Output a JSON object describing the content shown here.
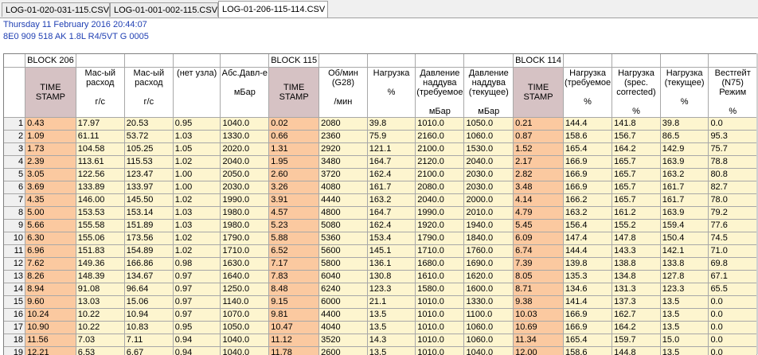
{
  "tabs": [
    "LOG-01-020-031-115.CSV",
    "LOG-01-001-002-115.CSV",
    "LOG-01-206-115-114.CSV"
  ],
  "active_tab": 2,
  "info": {
    "date": "Thursday 11 February 2016 20:44:07",
    "vehicle": "8E0 909 518 AK  1.8L R4/5VT     G    0005"
  },
  "blocks": {
    "b206": "BLOCK 206",
    "b115": "BLOCK 115",
    "b114": "BLOCK 114"
  },
  "headers": [
    {
      "top": "TIME STAMP",
      "unit": ""
    },
    {
      "top": "Мас-ый расход",
      "unit": "г/с"
    },
    {
      "top": "Мас-ый расход",
      "unit": "г/с"
    },
    {
      "top": "(нет узла)",
      "unit": ""
    },
    {
      "top": "Абс.Давл-е",
      "unit": "мБар"
    },
    {
      "top": "TIME STAMP",
      "unit": ""
    },
    {
      "top": "Об/мин (G28)",
      "unit": "/мин"
    },
    {
      "top": "Нагрузка",
      "unit": "%"
    },
    {
      "top": "Давление наддува (требуемое",
      "unit": "мБар"
    },
    {
      "top": "Давление наддува (текущее)",
      "unit": "мБар"
    },
    {
      "top": "TIME STAMP",
      "unit": ""
    },
    {
      "top": "Нагрузка (требуемое",
      "unit": "%"
    },
    {
      "top": "Нагрузка (spec. corrected)",
      "unit": "%"
    },
    {
      "top": "Нагрузка (текущее)",
      "unit": "%"
    },
    {
      "top": "Вестгейт (N75) Режим",
      "unit": "%"
    }
  ],
  "rows": [
    [
      "1",
      "0.43",
      "17.97",
      "20.53",
      "0.95",
      "1040.0",
      "0.02",
      "2080",
      "39.8",
      "1010.0",
      "1050.0",
      "0.21",
      "144.4",
      "141.8",
      "39.8",
      "0.0"
    ],
    [
      "2",
      "1.09",
      "61.11",
      "53.72",
      "1.03",
      "1330.0",
      "0.66",
      "2360",
      "75.9",
      "2160.0",
      "1060.0",
      "0.87",
      "158.6",
      "156.7",
      "86.5",
      "95.3"
    ],
    [
      "3",
      "1.73",
      "104.58",
      "105.25",
      "1.05",
      "2020.0",
      "1.31",
      "2920",
      "121.1",
      "2100.0",
      "1530.0",
      "1.52",
      "165.4",
      "164.2",
      "142.9",
      "75.7"
    ],
    [
      "4",
      "2.39",
      "113.61",
      "115.53",
      "1.02",
      "2040.0",
      "1.95",
      "3480",
      "164.7",
      "2120.0",
      "2040.0",
      "2.17",
      "166.9",
      "165.7",
      "163.9",
      "78.8"
    ],
    [
      "5",
      "3.05",
      "122.56",
      "123.47",
      "1.00",
      "2050.0",
      "2.60",
      "3720",
      "162.4",
      "2100.0",
      "2030.0",
      "2.82",
      "166.9",
      "165.7",
      "163.2",
      "80.8"
    ],
    [
      "6",
      "3.69",
      "133.89",
      "133.97",
      "1.00",
      "2030.0",
      "3.26",
      "4080",
      "161.7",
      "2080.0",
      "2030.0",
      "3.48",
      "166.9",
      "165.7",
      "161.7",
      "82.7"
    ],
    [
      "7",
      "4.35",
      "146.00",
      "145.50",
      "1.02",
      "1990.0",
      "3.91",
      "4440",
      "163.2",
      "2040.0",
      "2000.0",
      "4.14",
      "166.2",
      "165.7",
      "161.7",
      "78.0"
    ],
    [
      "8",
      "5.00",
      "153.53",
      "153.14",
      "1.03",
      "1980.0",
      "4.57",
      "4800",
      "164.7",
      "1990.0",
      "2010.0",
      "4.79",
      "163.2",
      "161.2",
      "163.9",
      "79.2"
    ],
    [
      "9",
      "5.66",
      "155.58",
      "151.89",
      "1.03",
      "1980.0",
      "5.23",
      "5080",
      "162.4",
      "1920.0",
      "1940.0",
      "5.45",
      "156.4",
      "155.2",
      "159.4",
      "77.6"
    ],
    [
      "10",
      "6.30",
      "155.06",
      "173.56",
      "1.02",
      "1790.0",
      "5.88",
      "5360",
      "153.4",
      "1790.0",
      "1840.0",
      "6.09",
      "147.4",
      "147.8",
      "150.4",
      "74.5"
    ],
    [
      "11",
      "6.96",
      "151.83",
      "154.89",
      "1.02",
      "1710.0",
      "6.52",
      "5600",
      "145.1",
      "1710.0",
      "1760.0",
      "6.74",
      "144.4",
      "143.3",
      "142.1",
      "71.0"
    ],
    [
      "12",
      "7.62",
      "149.36",
      "166.86",
      "0.98",
      "1630.0",
      "7.17",
      "5800",
      "136.1",
      "1680.0",
      "1690.0",
      "7.39",
      "139.8",
      "138.8",
      "133.8",
      "69.8"
    ],
    [
      "13",
      "8.26",
      "148.39",
      "134.67",
      "0.97",
      "1640.0",
      "7.83",
      "6040",
      "130.8",
      "1610.0",
      "1620.0",
      "8.05",
      "135.3",
      "134.8",
      "127.8",
      "67.1"
    ],
    [
      "14",
      "8.94",
      "91.08",
      "96.64",
      "0.97",
      "1250.0",
      "8.48",
      "6240",
      "123.3",
      "1580.0",
      "1600.0",
      "8.71",
      "134.6",
      "131.3",
      "123.3",
      "65.5"
    ],
    [
      "15",
      "9.60",
      "13.03",
      "15.06",
      "0.97",
      "1140.0",
      "9.15",
      "6000",
      "21.1",
      "1010.0",
      "1330.0",
      "9.38",
      "141.4",
      "137.3",
      "13.5",
      "0.0"
    ],
    [
      "16",
      "10.24",
      "10.22",
      "10.94",
      "0.97",
      "1070.0",
      "9.81",
      "4400",
      "13.5",
      "1010.0",
      "1100.0",
      "10.03",
      "166.9",
      "162.7",
      "13.5",
      "0.0"
    ],
    [
      "17",
      "10.90",
      "10.22",
      "10.83",
      "0.95",
      "1050.0",
      "10.47",
      "4040",
      "13.5",
      "1010.0",
      "1060.0",
      "10.69",
      "166.9",
      "164.2",
      "13.5",
      "0.0"
    ],
    [
      "18",
      "11.56",
      "7.03",
      "7.11",
      "0.94",
      "1040.0",
      "11.12",
      "3520",
      "14.3",
      "1010.0",
      "1060.0",
      "11.34",
      "165.4",
      "159.7",
      "15.0",
      "0.0"
    ],
    [
      "19",
      "12.21",
      "6.53",
      "6.67",
      "0.94",
      "1040.0",
      "11.78",
      "2600",
      "13.5",
      "1010.0",
      "1040.0",
      "12.00",
      "158.6",
      "144.8",
      "13.5",
      "0.0"
    ]
  ]
}
